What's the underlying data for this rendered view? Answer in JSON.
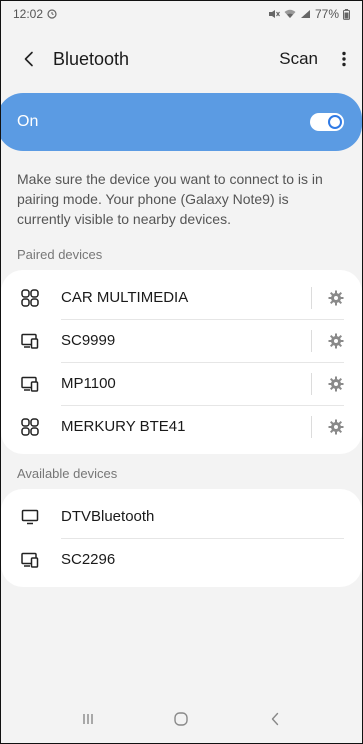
{
  "status_bar": {
    "time": "12:02",
    "battery": "77%"
  },
  "header": {
    "title": "Bluetooth",
    "scan_label": "Scan"
  },
  "toggle": {
    "label": "On",
    "state": "on"
  },
  "description": "Make sure the device you want to connect to is in pairing mode. Your phone (Galaxy Note9) is currently visible to nearby devices.",
  "paired": {
    "title": "Paired devices",
    "devices": [
      {
        "name": "CAR MULTIMEDIA",
        "icon": "multimedia-icon"
      },
      {
        "name": "SC9999",
        "icon": "phone-computer-icon"
      },
      {
        "name": "MP1100",
        "icon": "phone-computer-icon"
      },
      {
        "name": "MERKURY BTE41",
        "icon": "multimedia-icon"
      }
    ]
  },
  "available": {
    "title": "Available devices",
    "devices": [
      {
        "name": "DTVBluetooth",
        "icon": "monitor-icon"
      },
      {
        "name": "SC2296",
        "icon": "phone-computer-icon"
      }
    ]
  },
  "colors": {
    "accent": "#5b9be3",
    "background": "#f3f3f3",
    "card": "#ffffff"
  }
}
